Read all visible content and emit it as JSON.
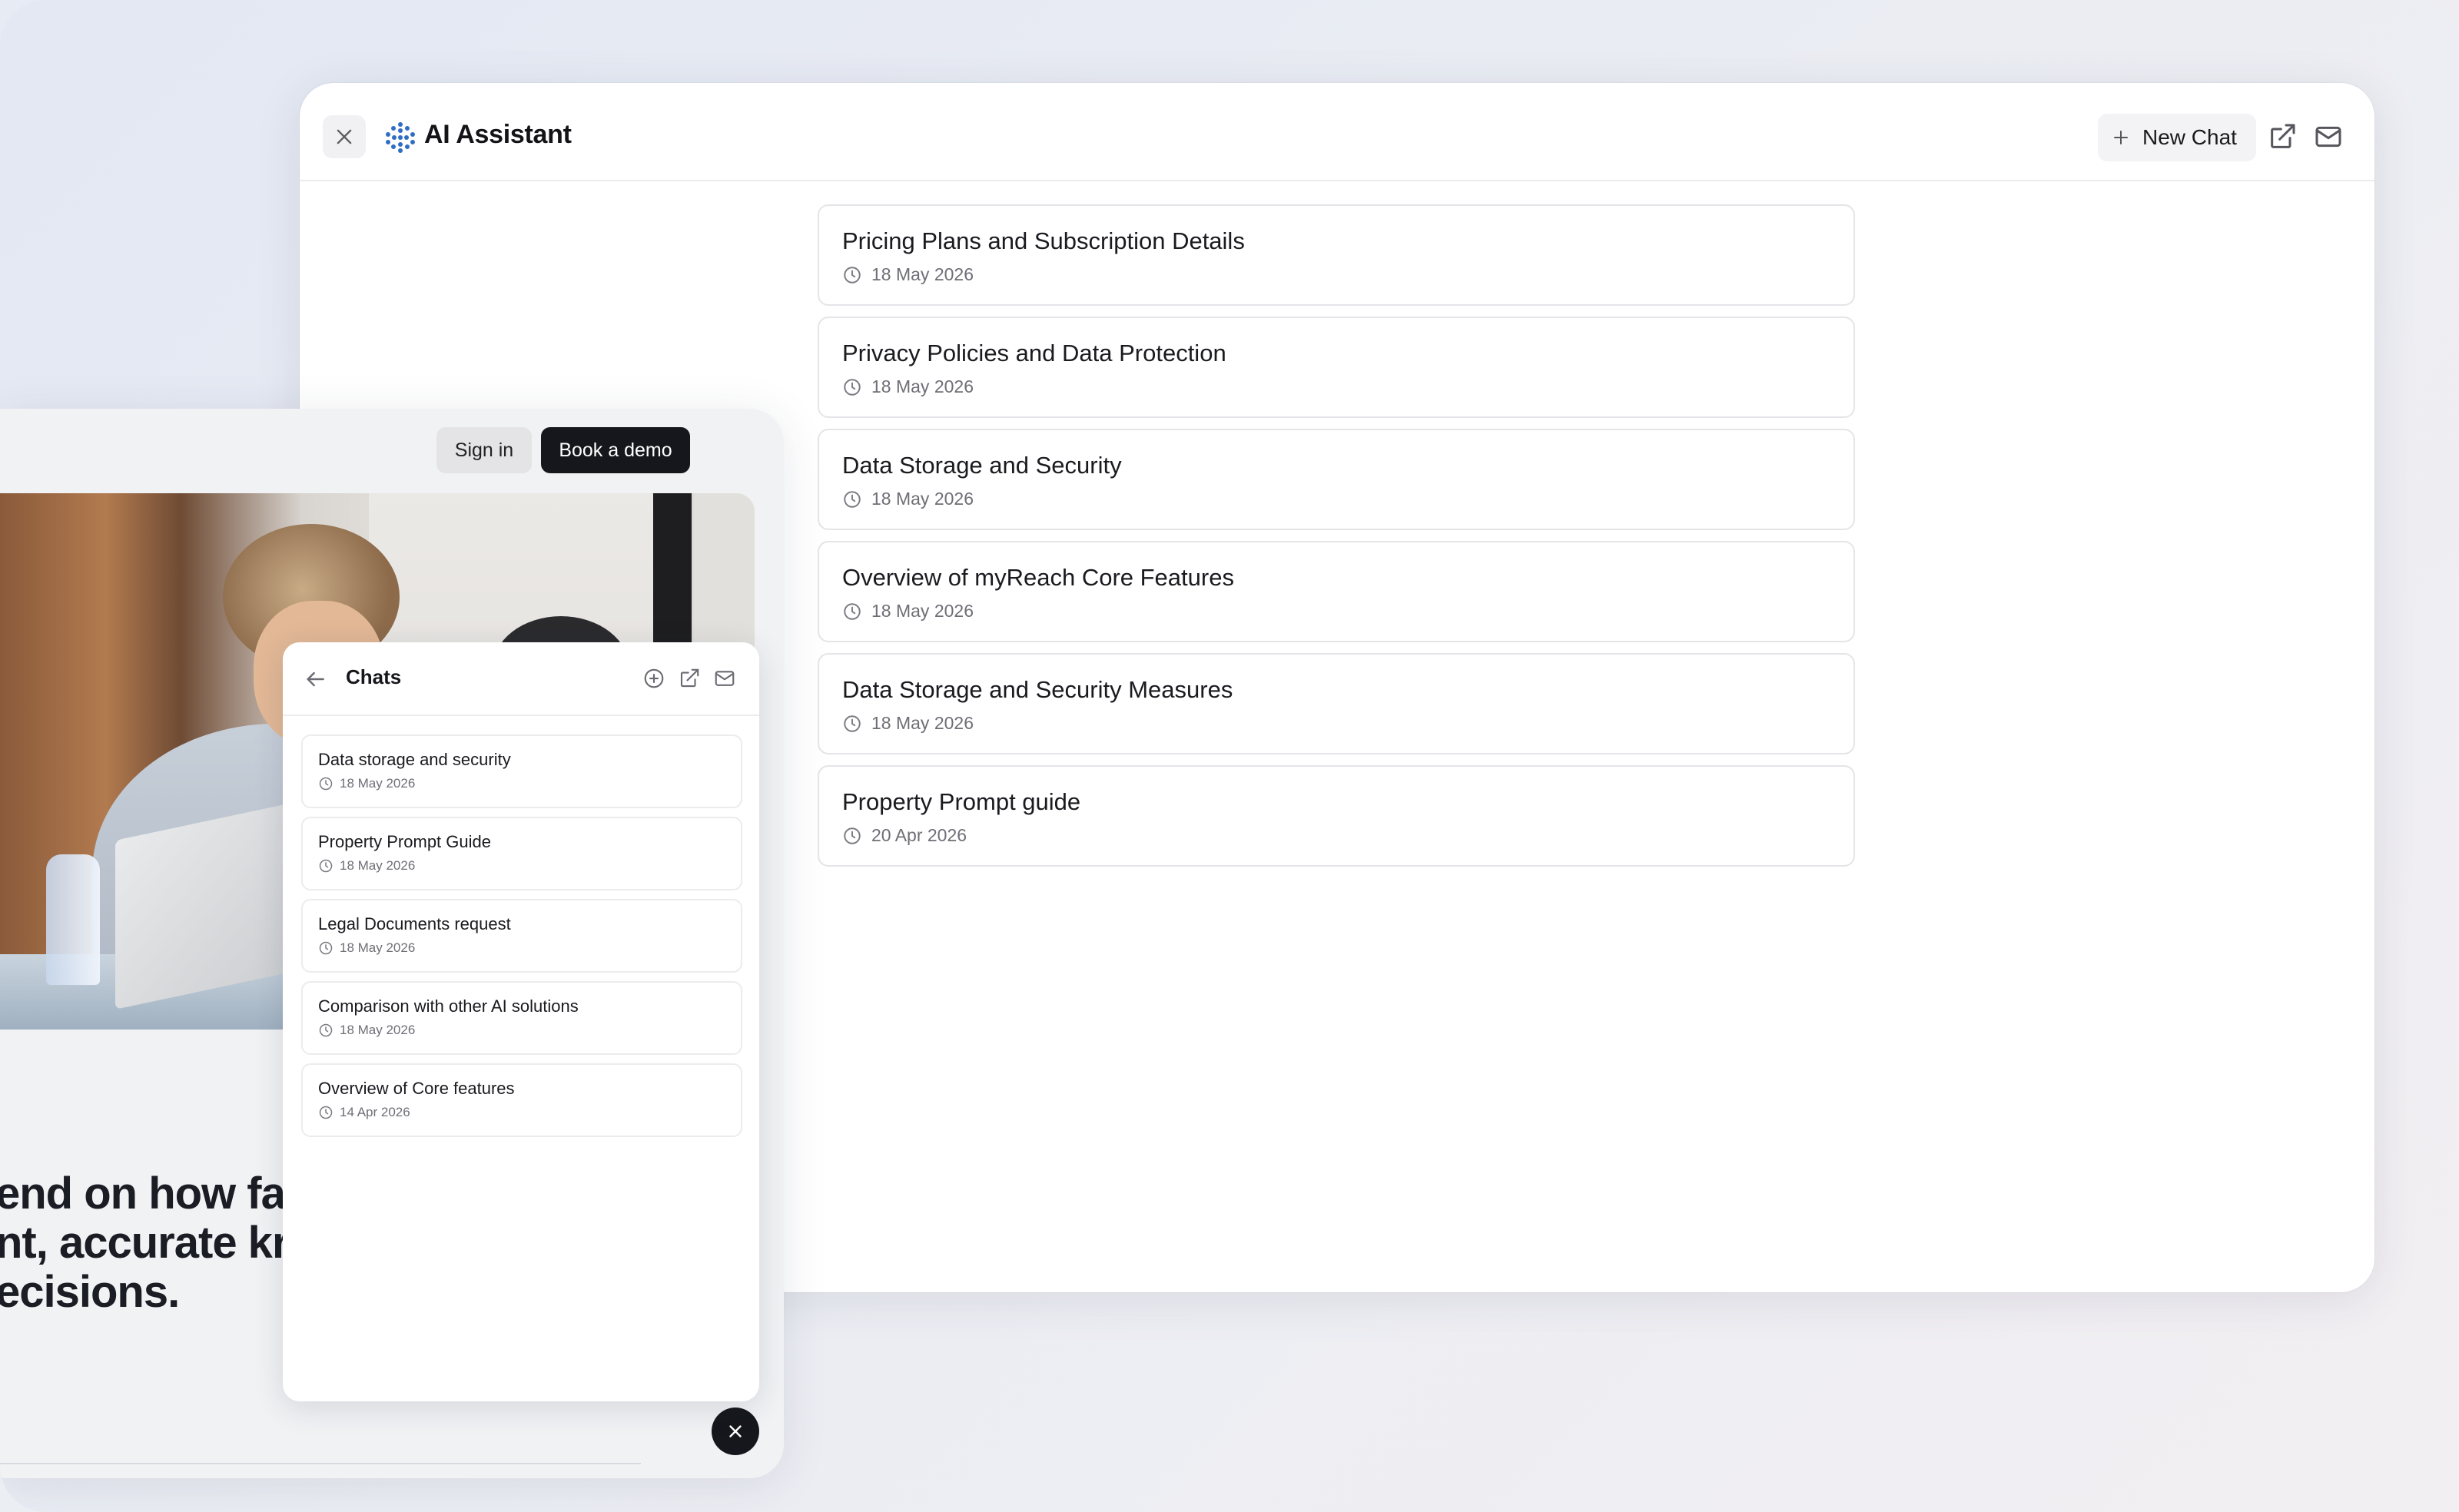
{
  "assistant": {
    "title": "AI Assistant",
    "new_chat_label": "New Chat",
    "conversations": [
      {
        "title": "Pricing Plans and Subscription Details",
        "date": "18 May 2026"
      },
      {
        "title": "Privacy Policies and Data Protection",
        "date": "18 May 2026"
      },
      {
        "title": "Data Storage and Security",
        "date": "18 May 2026"
      },
      {
        "title": "Overview of myReach Core Features",
        "date": "18 May 2026"
      },
      {
        "title": "Data Storage and Security Measures",
        "date": "18 May 2026"
      },
      {
        "title": "Property Prompt guide",
        "date": "20 Apr 2026"
      }
    ]
  },
  "website": {
    "sign_in_label": "Sign in",
    "demo_label": "Book a demo",
    "headline_lines": [
      "end on how fas",
      "nt, accurate kr",
      "ecisions."
    ]
  },
  "widget": {
    "title": "Chats",
    "chats": [
      {
        "title": "Data storage and security",
        "date": "18 May 2026"
      },
      {
        "title": "Property Prompt Guide",
        "date": "18 May 2026"
      },
      {
        "title": "Legal Documents request",
        "date": "18 May 2026"
      },
      {
        "title": "Comparison with other AI solutions",
        "date": "18 May 2026"
      },
      {
        "title": "Overview of Core features",
        "date": "14 Apr 2026"
      }
    ]
  },
  "colors": {
    "accent_dark": "#15171c",
    "logo_blue": "#2f6ec4",
    "border": "#e5e5e9",
    "muted_text": "#6e6e76"
  },
  "icons": [
    "close-icon",
    "logo-icon",
    "plus-icon",
    "external-link-icon",
    "mail-icon",
    "clock-icon",
    "back-arrow-icon",
    "add-circle-icon"
  ]
}
